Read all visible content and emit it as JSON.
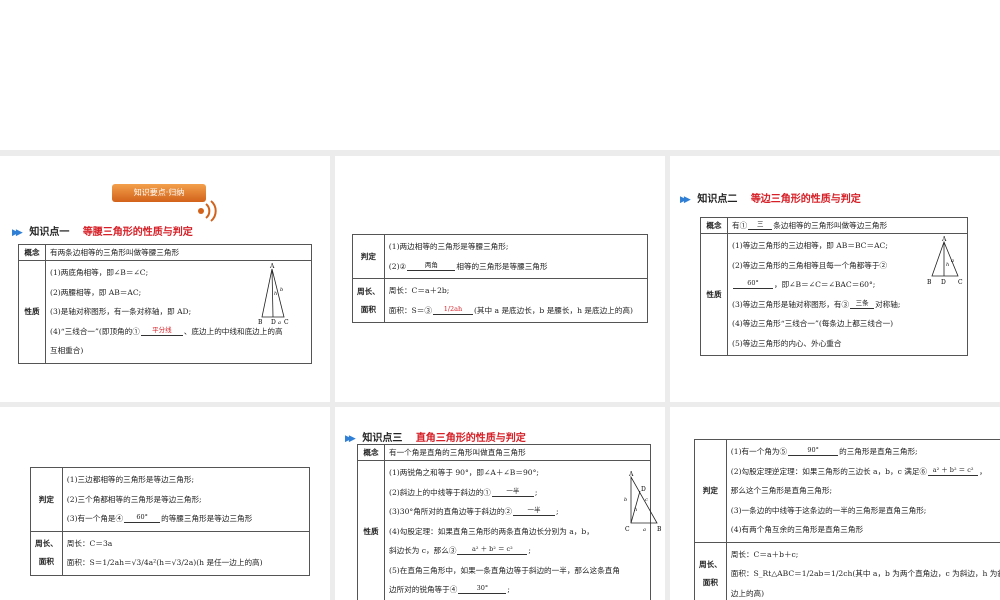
{
  "p1": {
    "badge": "知识要点·归纳",
    "kp_num": "知识点一",
    "kp_title": "等腰三角形的性质与判定",
    "def_head": "概念",
    "def_text": "有两条边相等的三角形叫做等腰三角形",
    "prop_head": "性质",
    "l1": "(1)两底角相等，即∠B＝∠C;",
    "l2": "(2)两腰相等，即 AB＝AC;",
    "l3": "(3)是轴对称图形，有一条对称轴，即 AD;",
    "l4a": "(4)“三线合一”(即顶角的①",
    "l4_blank": "平分线",
    "l4b": "、底边上的中线和底边上的高",
    "l4c": "互相重合)",
    "fig": {
      "A": "A",
      "B": "B",
      "D": "D",
      "C": "C",
      "a": "a",
      "b": "b",
      "h": "h"
    }
  },
  "p2": {
    "judge_head": "判定",
    "j1": "(1)两边相等的三角形是等腰三角形;",
    "j2a": "(2)②",
    "j2_blank": "两角",
    "j2b": "相等的三角形是等腰三角形",
    "pa_head_1": "周长、",
    "pa_head_2": "面积",
    "perim": "周长：C＝a＋2b;",
    "area_a": "面积：S＝③",
    "area_blank": "1/2ah",
    "area_b": "(其中 a 是底边长，b 是腰长，h 是底边上的高)"
  },
  "p3": {
    "kp_num": "知识点二",
    "kp_title": "等边三角形的性质与判定",
    "def_head": "概念",
    "def_a": "有①",
    "def_blank": "三",
    "def_b": "条边相等的三角形叫做等边三角形",
    "prop_head": "性质",
    "l1": "(1)等边三角形的三边相等，即 AB＝BC＝AC;",
    "l2": "(2)等边三角形的三角相等且每一个角都等于②",
    "l2_blank": "60°",
    "l2b": "，即∠B＝∠C＝∠BAC＝60°;",
    "l3a": "(3)等边三角形是轴对称图形，有③",
    "l3_blank": "三条",
    "l3b": "对称轴;",
    "l4": "(4)等边三角形“三线合一”(每条边上都三线合一)",
    "l5": "(5)等边三角形的内心、外心重合",
    "fig": {
      "A": "A",
      "B": "B",
      "D": "D",
      "C": "C",
      "a": "a",
      "h": "h"
    }
  },
  "p4": {
    "judge_head": "判定",
    "j1": "(1)三边都相等的三角形是等边三角形;",
    "j2": "(2)三个角都相等的三角形是等边三角形;",
    "j3a": "(3)有一个角是④",
    "j3_blank": "60°",
    "j3b": "的等腰三角形是等边三角形",
    "pa_head_1": "周长、",
    "pa_head_2": "面积",
    "perim": "周长：C＝3a",
    "area": "面积：S＝1/2ah＝√3/4a²(h＝√3/2a)(h 是任一边上的高)"
  },
  "p5": {
    "kp_num": "知识点三",
    "kp_title": "直角三角形的性质与判定",
    "def_head": "概念",
    "def_text": "有一个角是直角的三角形叫做直角三角形",
    "prop_head": "性质",
    "l1": "(1)两锐角之和等于 90°，即∠A＋∠B＝90°;",
    "l2a": "(2)斜边上的中线等于斜边的①",
    "l2_blank": "一半",
    "l3a": "(3)30°角所对的直角边等于斜边的②",
    "l3_blank": "一半",
    "l4": "(4)勾股定理：如果直角三角形的两条直角边长分别为 a，b，",
    "l4b": "斜边长为 c，那么③",
    "l4_blank": "a² ＋ b² ＝ c²",
    "l5": "(5)在直角三角形中，如果一条直角边等于斜边的一半，那么这条直角",
    "l5b": "边所对的锐角等于④",
    "l5_blank": "30°",
    "fig": {
      "A": "A",
      "B": "B",
      "C": "C",
      "D": "D",
      "a": "a",
      "b": "b",
      "c": "c",
      "h": "h"
    }
  },
  "p6": {
    "judge_head": "判定",
    "j1a": "(1)有一个角为⑤",
    "j1_blank": "90°",
    "j1b": "的三角形是直角三角形;",
    "j2a": "(2)勾股定理逆定理：如果三角形的三边长 a，b，c 满足⑥",
    "j2_blank": "a² ＋ b² ＝ c²",
    "j2b": "，",
    "j2c": "那么这个三角形是直角三角形;",
    "j3": "(3)一条边的中线等于这条边的一半的三角形是直角三角形;",
    "j4": "(4)有两个角互余的三角形是直角三角形",
    "pa_head_1": "周长、",
    "pa_head_2": "面积",
    "perim": "周长：C＝a＋b＋c;",
    "area": "面积：S_Rt△ABC＝1/2ab＝1/2ch(其中 a，b 为两个直角边，c 为斜边，h 为斜",
    "area_b": "边上的高)"
  }
}
